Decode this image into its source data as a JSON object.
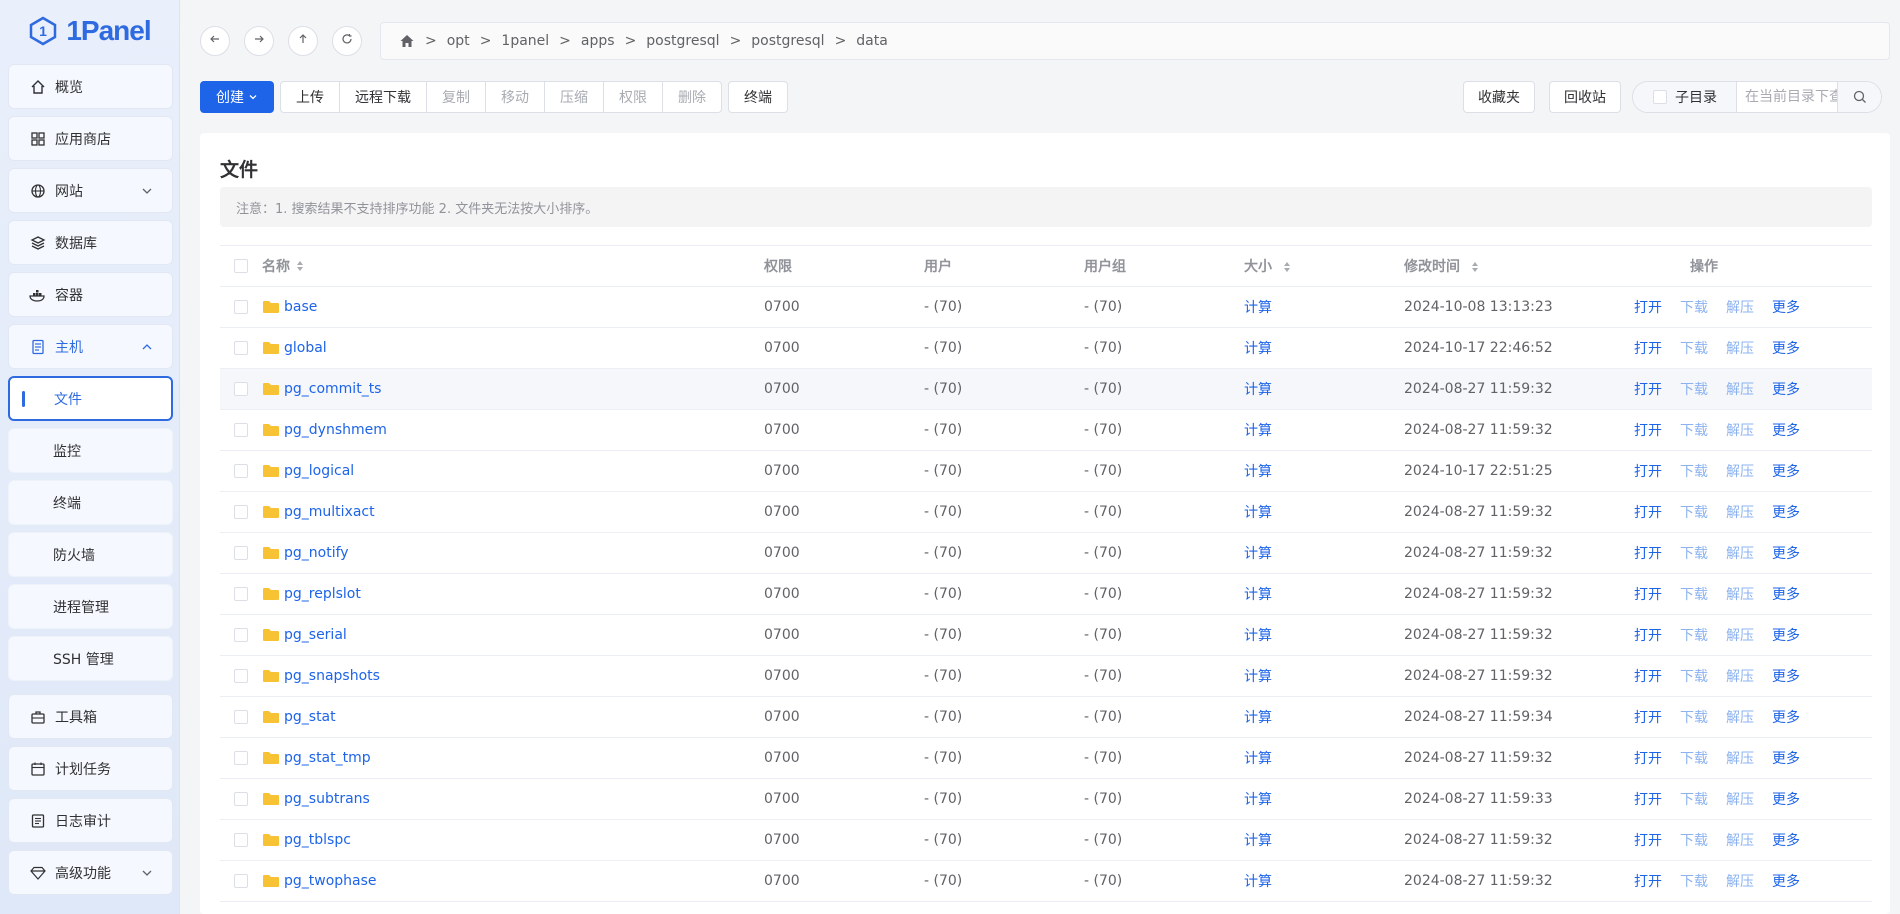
{
  "app": {
    "logo_text": "1Panel"
  },
  "sidebar": {
    "items": [
      {
        "label": "概览",
        "icon": "home-icon"
      },
      {
        "label": "应用商店",
        "icon": "grid-icon"
      },
      {
        "label": "网站",
        "icon": "globe-icon"
      },
      {
        "label": "数据库",
        "icon": "layers-icon"
      },
      {
        "label": "容器",
        "icon": "docker-icon"
      },
      {
        "label": "主机",
        "icon": "server-icon"
      },
      {
        "label": "工具箱",
        "icon": "toolbox-icon"
      },
      {
        "label": "计划任务",
        "icon": "calendar-icon"
      },
      {
        "label": "日志审计",
        "icon": "log-icon"
      },
      {
        "label": "高级功能",
        "icon": "diamond-icon"
      }
    ],
    "host_sub": [
      "文件",
      "监控",
      "终端",
      "防火墙",
      "进程管理",
      "SSH 管理"
    ]
  },
  "breadcrumb": [
    "opt",
    "1panel",
    "apps",
    "postgresql",
    "postgresql",
    "data"
  ],
  "toolbar": {
    "create": "创建",
    "group": [
      "上传",
      "远程下载",
      "复制",
      "移动",
      "压缩",
      "权限",
      "删除"
    ],
    "terminal": "终端",
    "favorites": "收藏夹",
    "recycle": "回收站",
    "subdir": "子目录",
    "search_placeholder": "在当前目录下查找"
  },
  "card": {
    "title": "文件",
    "notice": "注意：1. 搜索结果不支持排序功能 2. 文件夹无法按大小排序。"
  },
  "table": {
    "headers": {
      "name": "名称",
      "perm": "权限",
      "user": "用户",
      "group": "用户组",
      "size": "大小",
      "time": "修改时间",
      "ops": "操作"
    },
    "ops": [
      "打开",
      "下载",
      "解压",
      "更多"
    ],
    "size_action": "计算",
    "rows": [
      {
        "name": "base",
        "perm": "0700",
        "user": "- (70)",
        "group": "- (70)",
        "time": "2024-10-08 13:13:23"
      },
      {
        "name": "global",
        "perm": "0700",
        "user": "- (70)",
        "group": "- (70)",
        "time": "2024-10-17 22:46:52"
      },
      {
        "name": "pg_commit_ts",
        "perm": "0700",
        "user": "- (70)",
        "group": "- (70)",
        "time": "2024-08-27 11:59:32"
      },
      {
        "name": "pg_dynshmem",
        "perm": "0700",
        "user": "- (70)",
        "group": "- (70)",
        "time": "2024-08-27 11:59:32"
      },
      {
        "name": "pg_logical",
        "perm": "0700",
        "user": "- (70)",
        "group": "- (70)",
        "time": "2024-10-17 22:51:25"
      },
      {
        "name": "pg_multixact",
        "perm": "0700",
        "user": "- (70)",
        "group": "- (70)",
        "time": "2024-08-27 11:59:32"
      },
      {
        "name": "pg_notify",
        "perm": "0700",
        "user": "- (70)",
        "group": "- (70)",
        "time": "2024-08-27 11:59:32"
      },
      {
        "name": "pg_replslot",
        "perm": "0700",
        "user": "- (70)",
        "group": "- (70)",
        "time": "2024-08-27 11:59:32"
      },
      {
        "name": "pg_serial",
        "perm": "0700",
        "user": "- (70)",
        "group": "- (70)",
        "time": "2024-08-27 11:59:32"
      },
      {
        "name": "pg_snapshots",
        "perm": "0700",
        "user": "- (70)",
        "group": "- (70)",
        "time": "2024-08-27 11:59:32"
      },
      {
        "name": "pg_stat",
        "perm": "0700",
        "user": "- (70)",
        "group": "- (70)",
        "time": "2024-08-27 11:59:34"
      },
      {
        "name": "pg_stat_tmp",
        "perm": "0700",
        "user": "- (70)",
        "group": "- (70)",
        "time": "2024-08-27 11:59:32"
      },
      {
        "name": "pg_subtrans",
        "perm": "0700",
        "user": "- (70)",
        "group": "- (70)",
        "time": "2024-08-27 11:59:33"
      },
      {
        "name": "pg_tblspc",
        "perm": "0700",
        "user": "- (70)",
        "group": "- (70)",
        "time": "2024-08-27 11:59:32"
      },
      {
        "name": "pg_twophase",
        "perm": "0700",
        "user": "- (70)",
        "group": "- (70)",
        "time": "2024-08-27 11:59:32"
      }
    ]
  },
  "colors": {
    "accent": "#1d64e8",
    "folder": "#f7c234"
  }
}
